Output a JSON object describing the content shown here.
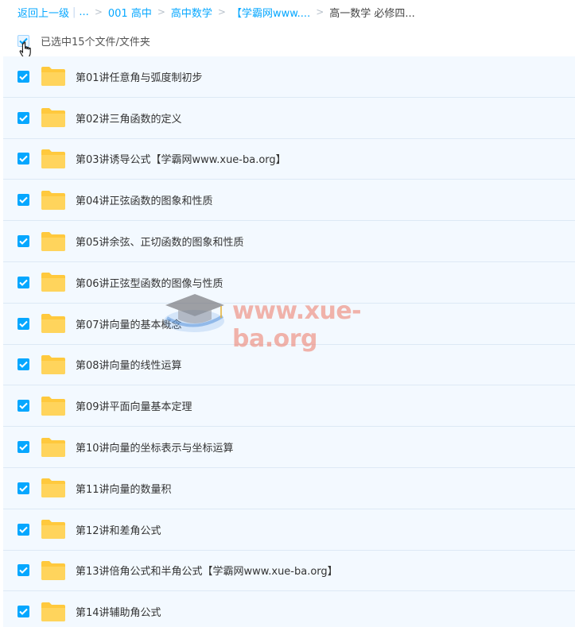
{
  "breadcrumb": {
    "back_label": "返回上一级",
    "ellipsis": "...",
    "items": [
      "001 高中",
      "高中数学",
      "【学霸网www....",
      "高一数学 必修四..."
    ]
  },
  "selection": {
    "label": "已选中15个文件/文件夹"
  },
  "files": [
    {
      "name": "第01讲任意角与弧度制初步"
    },
    {
      "name": "第02讲三角函数的定义"
    },
    {
      "name": "第03讲诱导公式【学霸网www.xue-ba.org】"
    },
    {
      "name": "第04讲正弦函数的图象和性质"
    },
    {
      "name": "第05讲余弦、正切函数的图象和性质"
    },
    {
      "name": "第06讲正弦型函数的图像与性质"
    },
    {
      "name": "第07讲向量的基本概念"
    },
    {
      "name": "第08讲向量的线性运算"
    },
    {
      "name": "第09讲平面向量基本定理"
    },
    {
      "name": "第10讲向量的坐标表示与坐标运算"
    },
    {
      "name": "第11讲向量的数量积"
    },
    {
      "name": "第12讲和差角公式"
    },
    {
      "name": "第13讲倍角公式和半角公式【学霸网www.xue-ba.org】"
    },
    {
      "name": "第14讲辅助角公式"
    }
  ],
  "watermark": {
    "text": "www.xue-ba.org"
  },
  "colors": {
    "accent": "#06a7ff",
    "folder": "#ffc93d",
    "row_bg": "#f3f9ff"
  }
}
